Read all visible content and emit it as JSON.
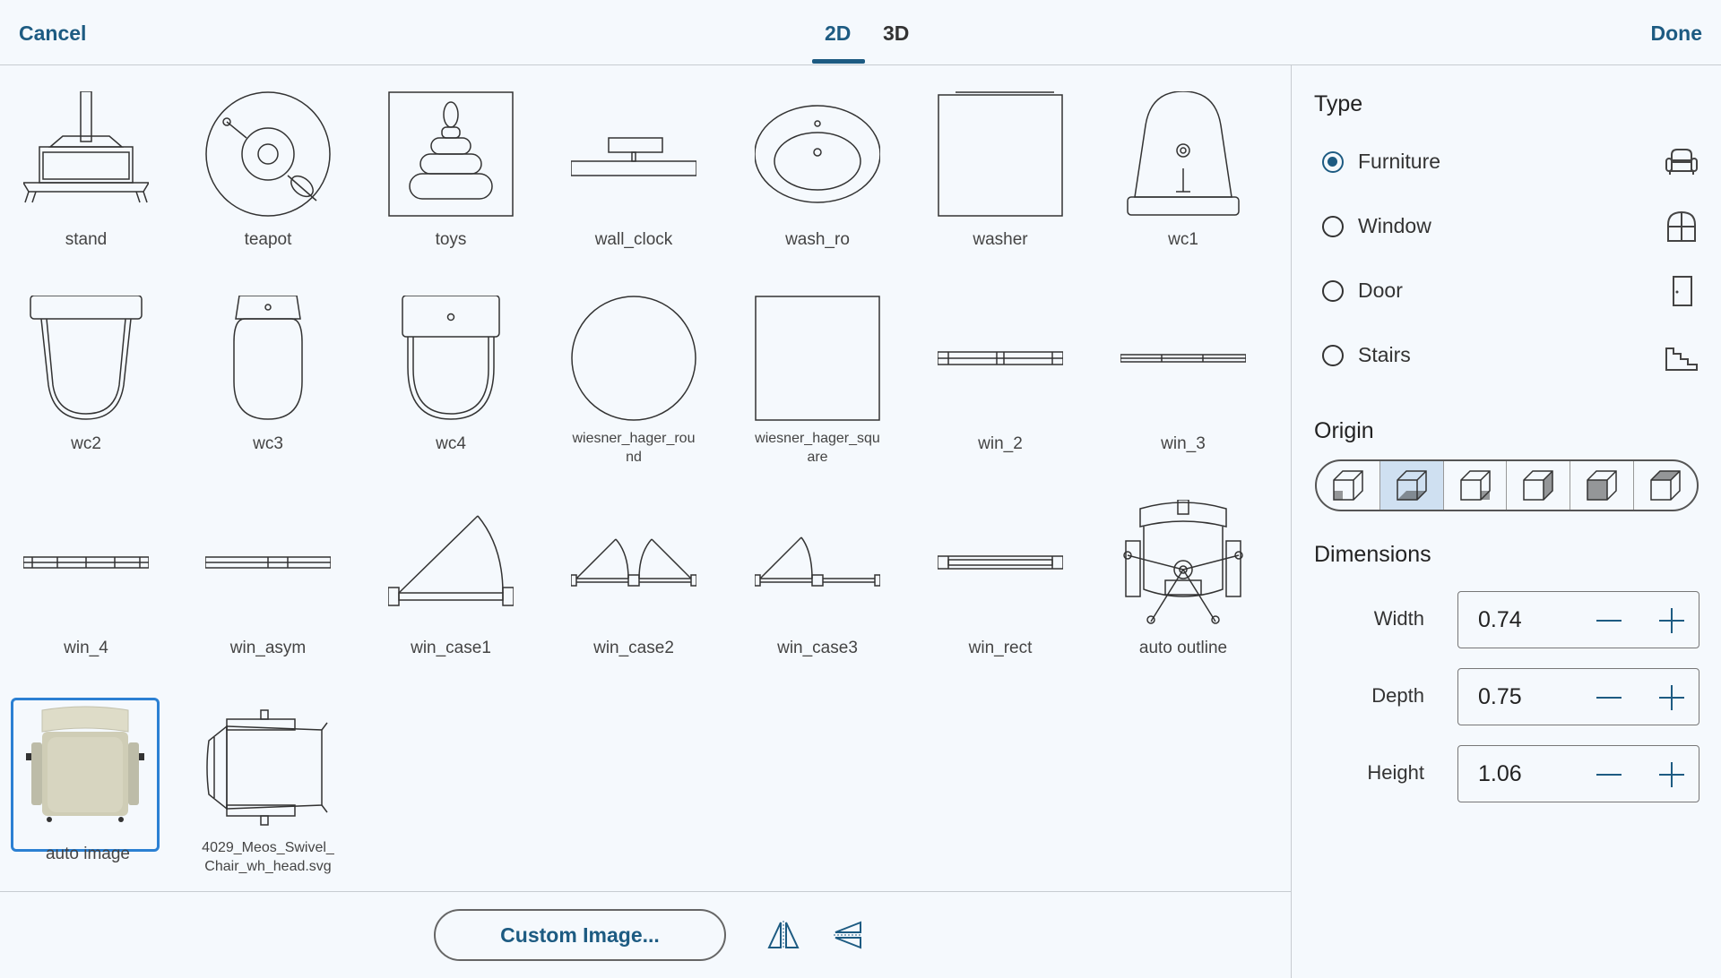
{
  "header": {
    "cancel_label": "Cancel",
    "done_label": "Done",
    "tabs": [
      {
        "label": "2D",
        "active": true
      },
      {
        "label": "3D",
        "active": false
      }
    ]
  },
  "library": {
    "items": [
      {
        "label": "stand"
      },
      {
        "label": "teapot"
      },
      {
        "label": "toys"
      },
      {
        "label": "wall_clock"
      },
      {
        "label": "wash_ro"
      },
      {
        "label": "washer"
      },
      {
        "label": "wc1"
      },
      {
        "label": "wc2"
      },
      {
        "label": "wc3"
      },
      {
        "label": "wc4"
      },
      {
        "label": "wiesner_hager_rou\nnd"
      },
      {
        "label": "wiesner_hager_squ\nare"
      },
      {
        "label": "win_2"
      },
      {
        "label": "win_3"
      },
      {
        "label": "win_4"
      },
      {
        "label": "win_asym"
      },
      {
        "label": "win_case1"
      },
      {
        "label": "win_case2"
      },
      {
        "label": "win_case3"
      },
      {
        "label": "win_rect"
      },
      {
        "label": "auto outline"
      },
      {
        "label": "auto image",
        "selected": true
      },
      {
        "label": "4029_Meos_Swivel_\nChair_wh_head.svg"
      }
    ]
  },
  "footer": {
    "custom_image_label": "Custom Image...",
    "flip_horizontal_icon": "flip-horizontal-icon",
    "flip_vertical_icon": "flip-vertical-icon"
  },
  "panel": {
    "type_title": "Type",
    "types": [
      {
        "label": "Furniture",
        "selected": true,
        "icon": "armchair-icon"
      },
      {
        "label": "Window",
        "selected": false,
        "icon": "window-icon"
      },
      {
        "label": "Door",
        "selected": false,
        "icon": "door-icon"
      },
      {
        "label": "Stairs",
        "selected": false,
        "icon": "stairs-icon"
      }
    ],
    "origin_title": "Origin",
    "origin_selected_index": 1,
    "dimensions_title": "Dimensions",
    "dimensions": [
      {
        "label": "Width",
        "value": "0.74"
      },
      {
        "label": "Depth",
        "value": "0.75"
      },
      {
        "label": "Height",
        "value": "1.06"
      }
    ]
  },
  "colors": {
    "accent": "#1d5b82",
    "selection_border": "#2b80d3",
    "background": "#f5f9fd",
    "origin_active": "#cfe0f1"
  }
}
